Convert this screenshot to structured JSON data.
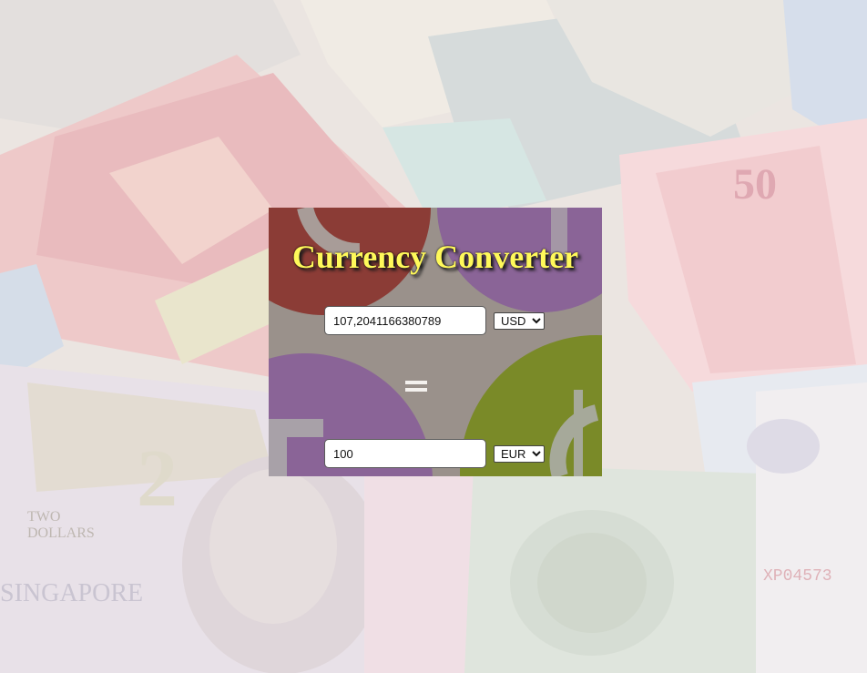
{
  "app": {
    "title": "Currency Converter"
  },
  "converter": {
    "from": {
      "amount": "107,2041166380789",
      "currency": "USD",
      "currency_options": [
        "USD"
      ]
    },
    "to": {
      "amount": "100",
      "currency": "EUR",
      "currency_options": [
        "EUR"
      ]
    },
    "equals_icon": "equals-icon"
  },
  "background": {
    "image_icon": "banknotes-background"
  },
  "colors": {
    "title_text": "#fff95a",
    "card_base": "#9a918b",
    "circle_red": "#8b3c36",
    "circle_purple": "#8a6497",
    "circle_green": "#7a8a28"
  }
}
